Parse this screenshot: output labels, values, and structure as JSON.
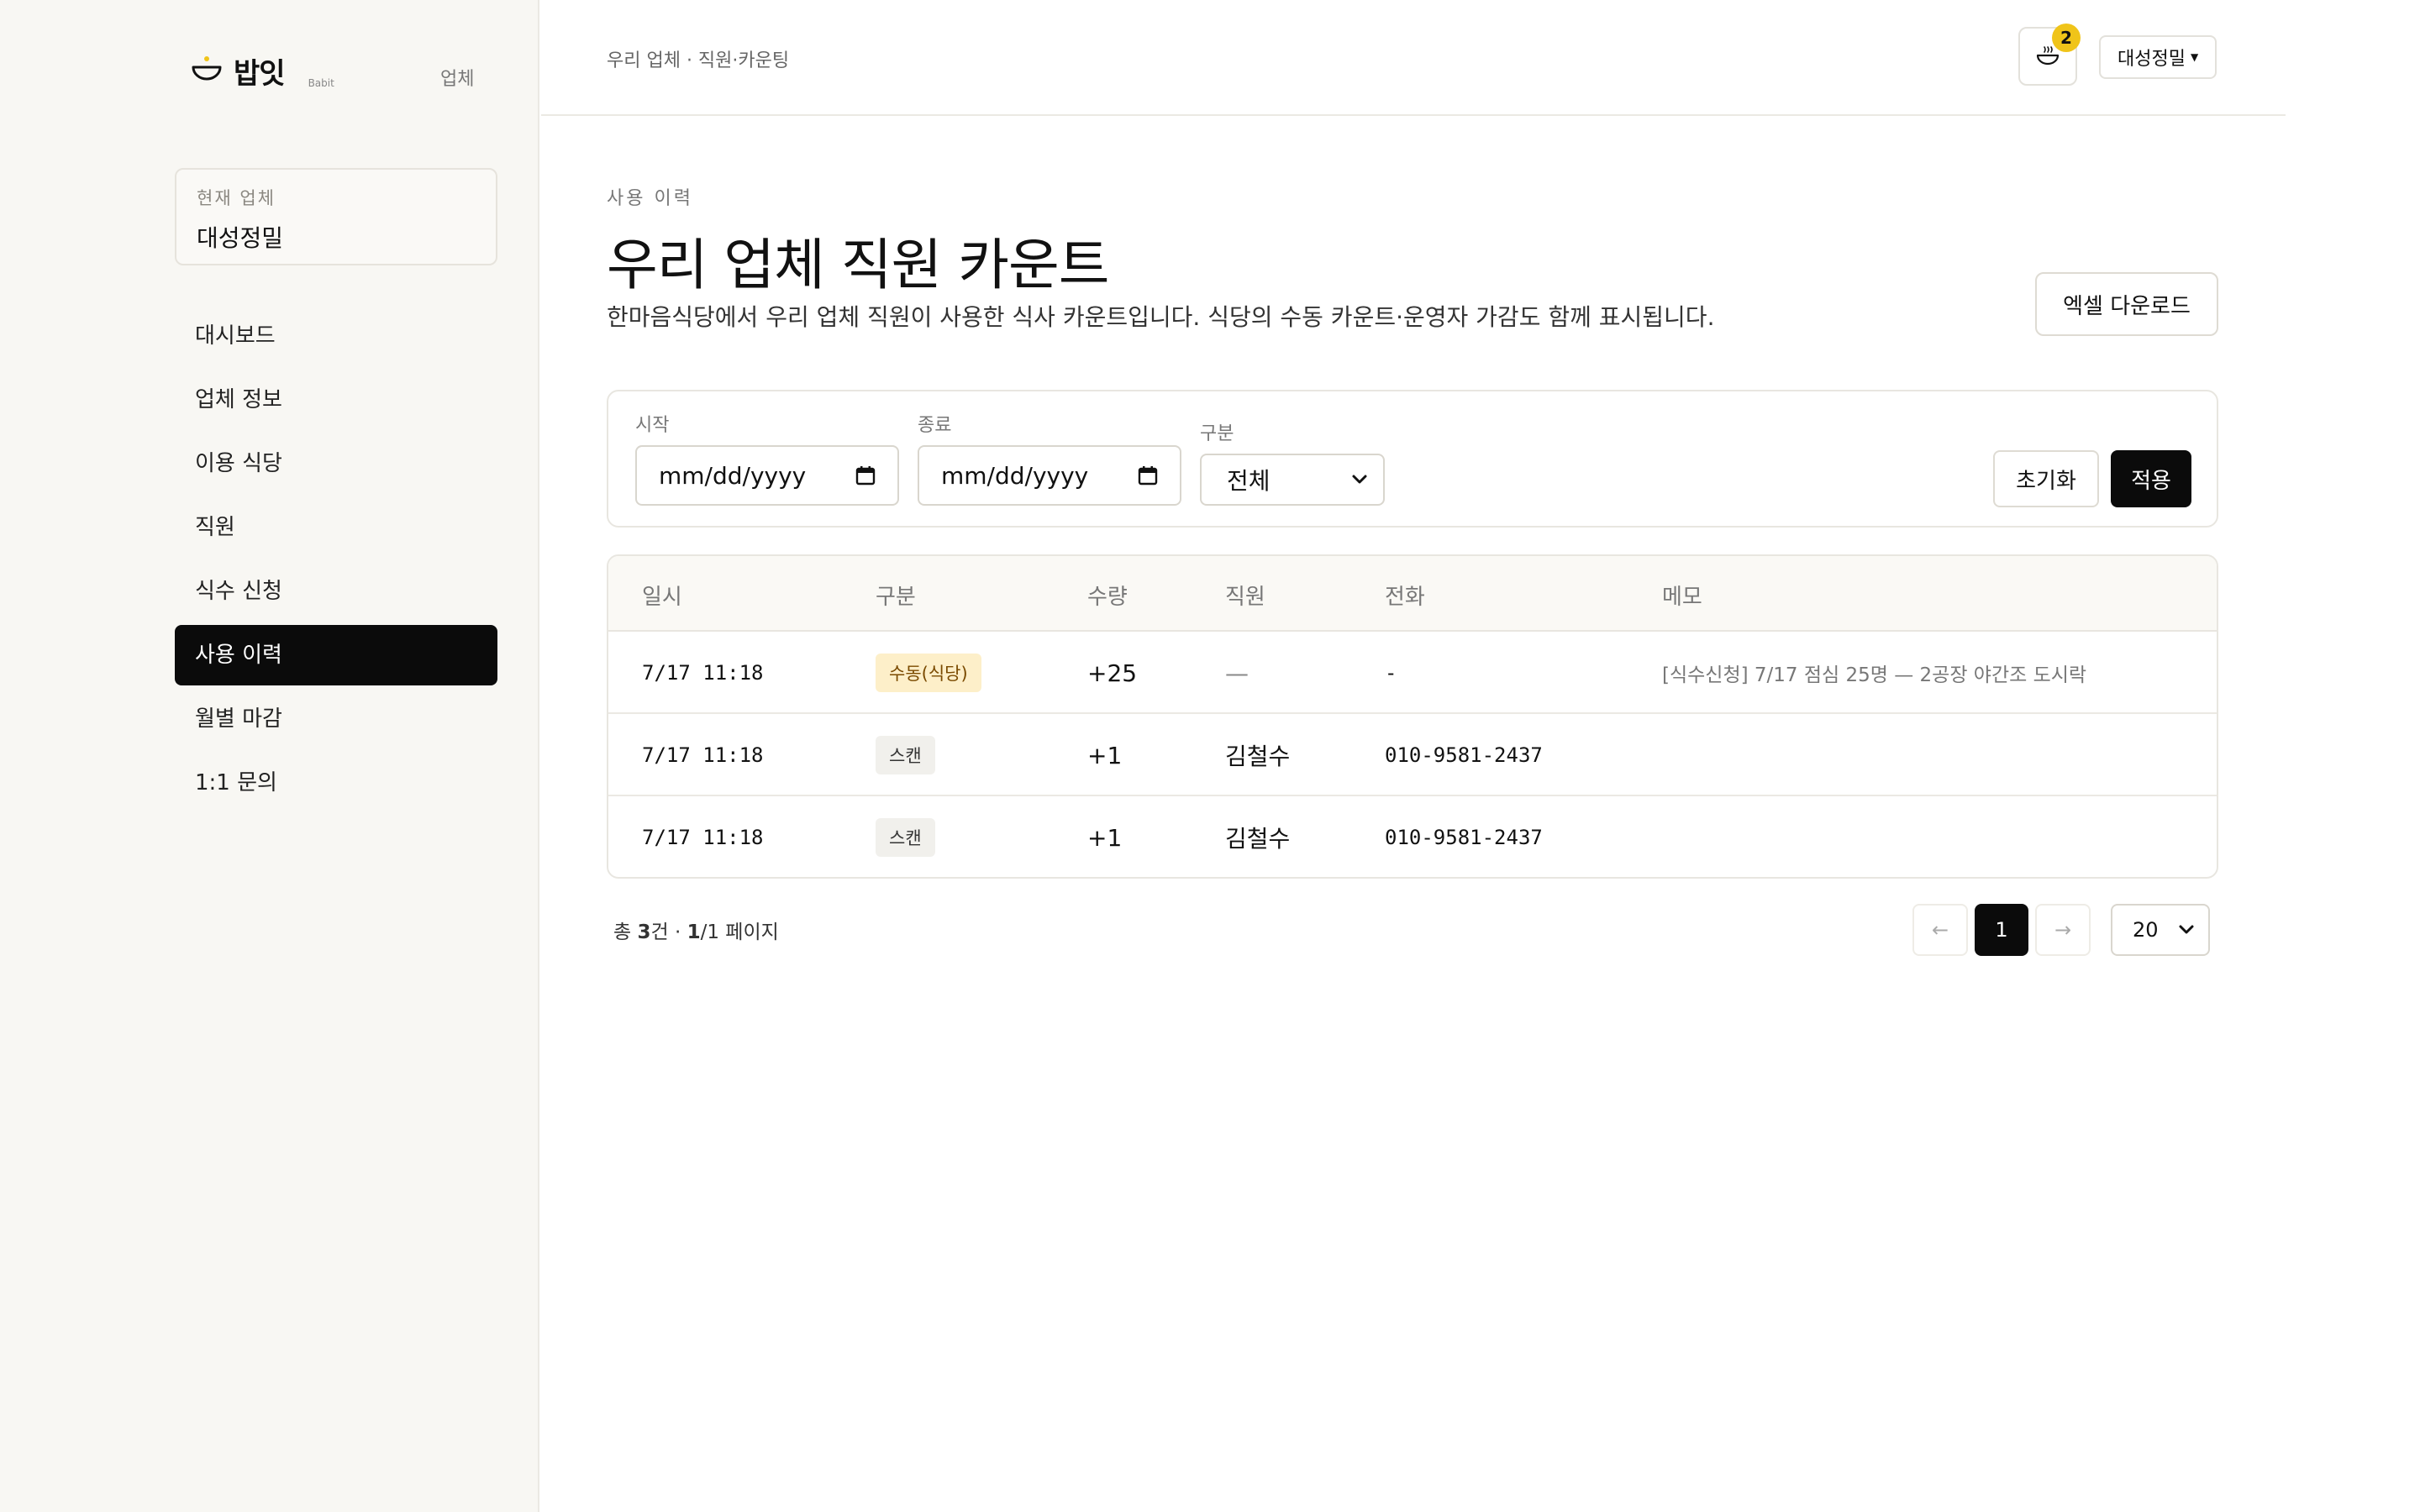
{
  "brand": {
    "name": "밥잇",
    "sub": "Babit",
    "role": "업체"
  },
  "current_company": {
    "label": "현재 업체",
    "value": "대성정밀"
  },
  "nav": [
    {
      "label": "대시보드",
      "active": false
    },
    {
      "label": "업체 정보",
      "active": false
    },
    {
      "label": "이용 식당",
      "active": false
    },
    {
      "label": "직원",
      "active": false
    },
    {
      "label": "식수 신청",
      "active": false
    },
    {
      "label": "사용 이력",
      "active": true
    },
    {
      "label": "월별 마감",
      "active": false
    },
    {
      "label": "1:1 문의",
      "active": false
    }
  ],
  "header": {
    "breadcrumb": "우리 업체 · 직원·카운팅",
    "notification_count": "2",
    "company_menu": "대성정밀"
  },
  "page": {
    "eyebrow": "사용 이력",
    "title": "우리 업체 직원 카운트",
    "description": "한마음식당에서 우리 업체 직원이 사용한 식사 카운트입니다. 식당의 수동 카운트·운영자 가감도 함께 표시됩니다.",
    "excel_button": "엑셀 다운로드"
  },
  "filters": {
    "start_label": "시작",
    "start_value": "mm/dd/yyyy",
    "end_label": "종료",
    "end_value": "mm/dd/yyyy",
    "type_label": "구분",
    "type_value": "전체",
    "reset_button": "초기화",
    "apply_button": "적용"
  },
  "table": {
    "columns": [
      "일시",
      "구분",
      "수량",
      "직원",
      "전화",
      "메모"
    ],
    "rows": [
      {
        "datetime": "7/17 11:18",
        "type": "수동(식당)",
        "type_kind": "manual",
        "qty": "+25",
        "employee": "—",
        "phone": "-",
        "memo": "[식수신청] 7/17 점심 25명 — 2공장 야간조 도시락"
      },
      {
        "datetime": "7/17 11:18",
        "type": "스캔",
        "type_kind": "scan",
        "qty": "+1",
        "employee": "김철수",
        "phone": "010-9581-2437",
        "memo": ""
      },
      {
        "datetime": "7/17 11:18",
        "type": "스캔",
        "type_kind": "scan",
        "qty": "+1",
        "employee": "김철수",
        "phone": "010-9581-2437",
        "memo": ""
      }
    ]
  },
  "pagination": {
    "total_prefix": "총 ",
    "total_count": "3",
    "total_mid": "건 · ",
    "current_page": "1",
    "total_pages_text": "/1 페이지",
    "prev": "←",
    "page_button": "1",
    "next": "→",
    "page_size": "20"
  },
  "colors": {
    "accent": "#0b0b0b",
    "badge_yellow": "#f0c419",
    "manual_badge_bg": "#fdefc9",
    "sidebar_bg": "#f8f7f3"
  }
}
